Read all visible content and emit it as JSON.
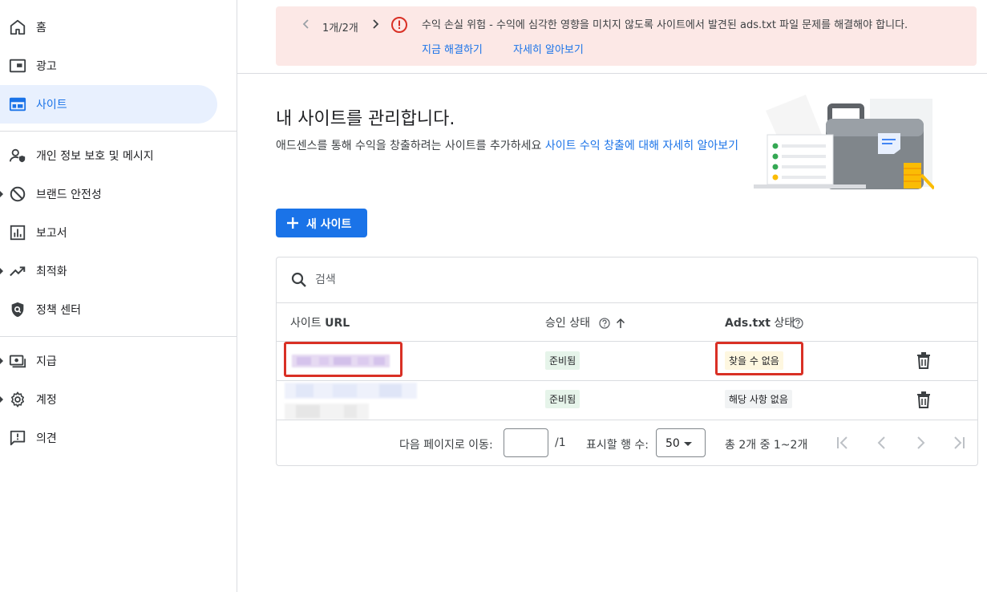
{
  "sidebar": {
    "items": [
      {
        "label": "홈",
        "icon": "home-icon"
      },
      {
        "label": "광고",
        "icon": "ad-unit-icon"
      },
      {
        "label": "사이트",
        "icon": "web-icon",
        "active": true
      },
      {
        "label": "개인 정보 보호 및 메시지",
        "icon": "person-shield-icon"
      },
      {
        "label": "브랜드 안전성",
        "icon": "block-icon"
      },
      {
        "label": "보고서",
        "icon": "bar-chart-icon"
      },
      {
        "label": "최적화",
        "icon": "trending-up-icon"
      },
      {
        "label": "정책 센터",
        "icon": "policy-icon"
      },
      {
        "label": "지급",
        "icon": "payments-icon"
      },
      {
        "label": "계정",
        "icon": "gear-icon"
      },
      {
        "label": "의견",
        "icon": "feedback-icon"
      }
    ]
  },
  "banner": {
    "page": "1개/2개",
    "message": "수익 손실 위험 - 수익에 심각한 영향을 미치지 않도록 사이트에서 발견된 ads.txt 파일 문제를 해결해야 합니다.",
    "fix_link": "지금 해결하기",
    "learn_link": "자세히 알아보기",
    "color": "#fce8e6"
  },
  "header": {
    "title": "내 사이트를 관리합니다.",
    "desc_text": "애드센스를 통해 수익을 창출하려는 사이트를 추가하세요",
    "desc_link": "사이트 수익 창출에 대해 자세히 알아보기"
  },
  "new_site_button": "새 사이트",
  "table": {
    "search_placeholder": "검색",
    "columns": {
      "url_prefix": "사이트",
      "url_bold": "URL",
      "approval": "승인 상태",
      "ads_bold": "Ads.txt",
      "ads_suffix": "상태"
    },
    "rows": [
      {
        "approval": "준비됨",
        "ads_status": "찾을 수 없음"
      },
      {
        "approval": "준비됨",
        "ads_status": "해당 사항 없음"
      }
    ],
    "footer": {
      "goto_label": "다음 페이지로 이동:",
      "page_total": "/1",
      "rows_label": "표시할 행 수:",
      "rows_value": "50",
      "range": "총 2개 중 1~2개"
    }
  },
  "colors": {
    "accent": "#1a73e8",
    "highlight_box": "#d93025",
    "ready_chip": "#e6f4ea",
    "not_found_chip": "#fef7e0"
  }
}
